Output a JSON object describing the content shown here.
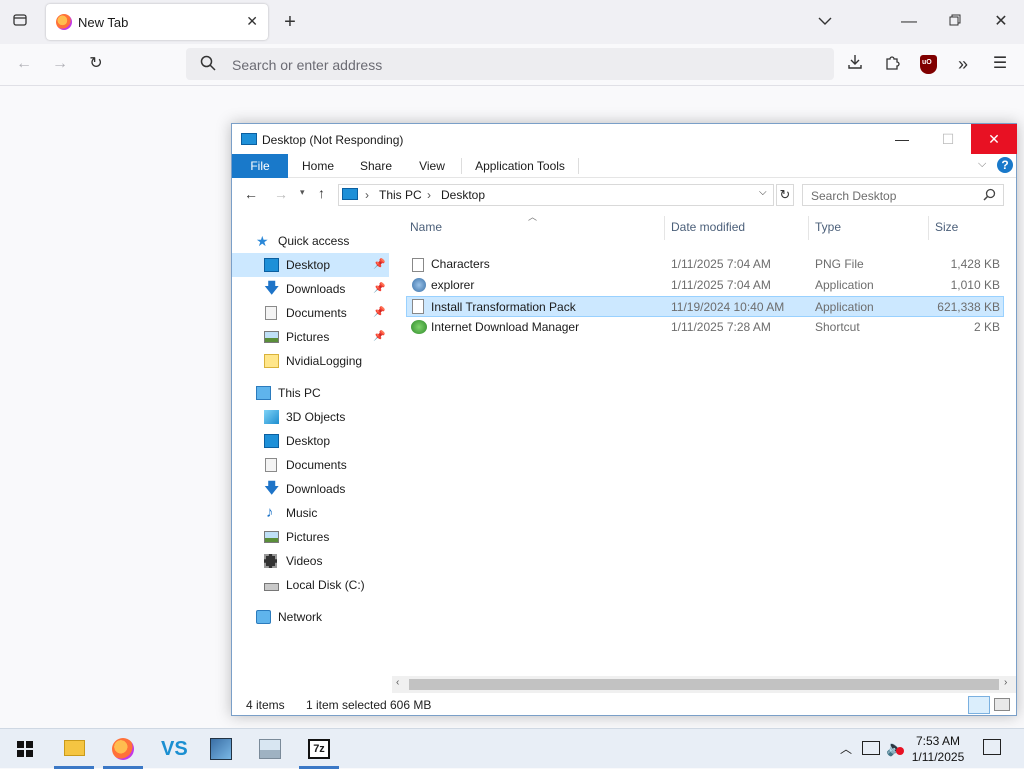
{
  "browser": {
    "tab_title": "New Tab",
    "address_placeholder": "Search or enter address",
    "ublock_badge": "uO"
  },
  "explorer": {
    "title": "Desktop (Not Responding)",
    "ribbon_tabs": [
      "File",
      "Home",
      "Share",
      "View",
      "Application Tools"
    ],
    "breadcrumb": [
      "This PC",
      "Desktop"
    ],
    "search_placeholder": "Search Desktop",
    "columns": [
      "Name",
      "Date modified",
      "Type",
      "Size"
    ],
    "files": [
      {
        "name": "Characters",
        "date": "1/11/2025 7:04 AM",
        "type": "PNG File",
        "size": "1,428 KB",
        "selected": false,
        "icon": "image-file-icon"
      },
      {
        "name": "explorer",
        "date": "1/11/2025 7:04 AM",
        "type": "Application",
        "size": "1,010 KB",
        "selected": false,
        "icon": "application-icon"
      },
      {
        "name": "Install Transformation Pack",
        "date": "11/19/2024 10:40 AM",
        "type": "Application",
        "size": "621,338 KB",
        "selected": true,
        "icon": "blank-file-icon"
      },
      {
        "name": "Internet Download Manager",
        "date": "1/11/2025 7:28 AM",
        "type": "Shortcut",
        "size": "2 KB",
        "selected": false,
        "icon": "idm-icon"
      }
    ],
    "tree": {
      "quick_access": "Quick access",
      "quick_items": [
        "Desktop",
        "Downloads",
        "Documents",
        "Pictures",
        "NvidiaLogging"
      ],
      "this_pc": "This PC",
      "pc_items": [
        "3D Objects",
        "Desktop",
        "Documents",
        "Downloads",
        "Music",
        "Pictures",
        "Videos",
        "Local Disk (C:)"
      ],
      "network": "Network"
    },
    "status": {
      "count": "4 items",
      "selection": "1 item selected",
      "size": "606 MB"
    }
  },
  "taskbar": {
    "time": "7:53 AM",
    "date": "1/11/2025",
    "app_7z": "7z"
  },
  "colors": {
    "accent": "#1979ca",
    "close_red": "#e81123",
    "selection": "#cce8ff"
  }
}
